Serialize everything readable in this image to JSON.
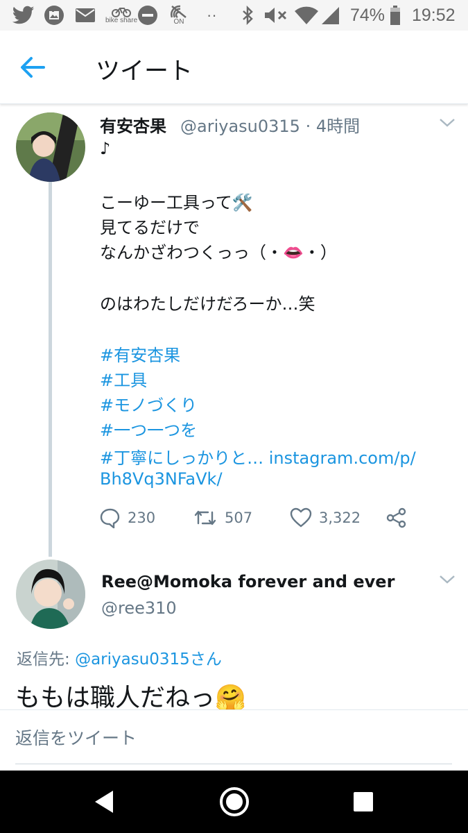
{
  "status_bar": {
    "bike_share_label": "bike share",
    "on_label": "ON",
    "dots": "··",
    "battery": "74%",
    "time": "19:52"
  },
  "app_bar": {
    "title": "ツイート"
  },
  "tweet": {
    "author_name": "有安杏果",
    "meta": "@ariyasu0315 · 4時間",
    "lines": [
      "♪",
      "",
      "こーゆー工具って🛠️",
      "見てるだけで",
      "なんかざわつくっっ（・👄・）",
      "",
      "のはわたしだけだろーか…笑"
    ],
    "hashtags": [
      "#有安杏果",
      "#工具",
      "#モノづくり",
      "#一つ一つを"
    ],
    "last_hashtag": "#丁寧にしっかりと…",
    "link_part1": "instagram.com/p/",
    "link_part2": "Bh8Vq3NFaVk/",
    "replies": "230",
    "retweets": "507",
    "likes": "3,322"
  },
  "reply": {
    "author_name": "Ree@Momoka forever and ever",
    "handle": "@ree310",
    "reply_to_label": "返信先: ",
    "reply_to_handle": "@ariyasu0315",
    "reply_to_suffix": "さん",
    "text": "ももは職人だねっ🤗"
  },
  "composer": {
    "placeholder": "返信をツイート"
  },
  "colors": {
    "link": "#1b95e0",
    "secondary_text": "#657786",
    "primary_text": "#14171a",
    "thread_line": "#ccd6dd"
  }
}
